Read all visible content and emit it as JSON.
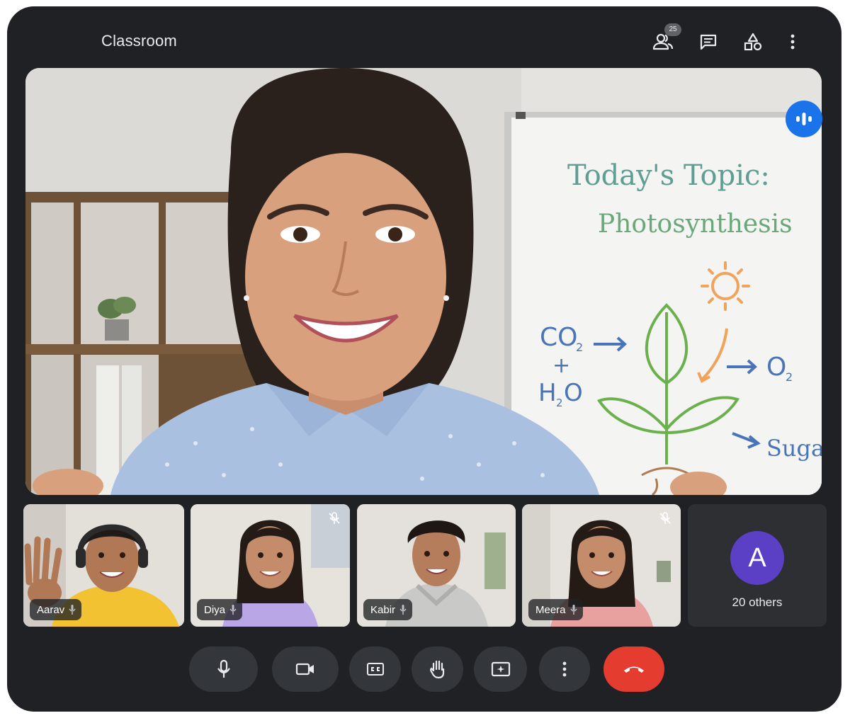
{
  "window": {
    "title": "Classroom"
  },
  "header": {
    "people_icon": "people-icon",
    "participant_count": "25",
    "chat_icon": "chat-icon",
    "activities_icon": "shapes-icon",
    "more_icon": "more-vert-icon"
  },
  "stage": {
    "speaker_state": "speaking",
    "whiteboard": {
      "title_line1": "Today's Topic:",
      "title_line2": "Photosynthesis",
      "co2": "CO",
      "co2_sub": "2",
      "plus": "+",
      "h2o_a": "H",
      "h2o_sub": "2",
      "h2o_b": "O",
      "o2": "O",
      "o2_sub": "2",
      "sugar": "Sugar"
    }
  },
  "participants": [
    {
      "name": "Aarav",
      "shirt": "#f2c233",
      "muted": false,
      "waving": true
    },
    {
      "name": "Diya",
      "shirt": "#b9a6e6",
      "muted": true,
      "waving": false
    },
    {
      "name": "Kabir",
      "shirt": "#c9c9c7",
      "muted": false,
      "waving": false
    },
    {
      "name": "Meera",
      "shirt": "#e9a1a0",
      "muted": true,
      "waving": false
    }
  ],
  "others": {
    "avatar_letter": "A",
    "label": "20 others",
    "avatar_color": "#5b3fc4"
  },
  "controls": [
    {
      "name": "mic",
      "icon": "mic-icon"
    },
    {
      "name": "camera",
      "icon": "videocam-icon"
    },
    {
      "name": "captions",
      "icon": "closed-caption-icon"
    },
    {
      "name": "raise-hand",
      "icon": "hand-icon"
    },
    {
      "name": "present",
      "icon": "present-icon"
    },
    {
      "name": "more",
      "icon": "more-vert-icon"
    },
    {
      "name": "leave",
      "icon": "call-end-icon"
    }
  ],
  "colors": {
    "background": "#1f2125",
    "control": "#33363b",
    "end_call": "#e53c30",
    "accent": "#1a73e8"
  }
}
